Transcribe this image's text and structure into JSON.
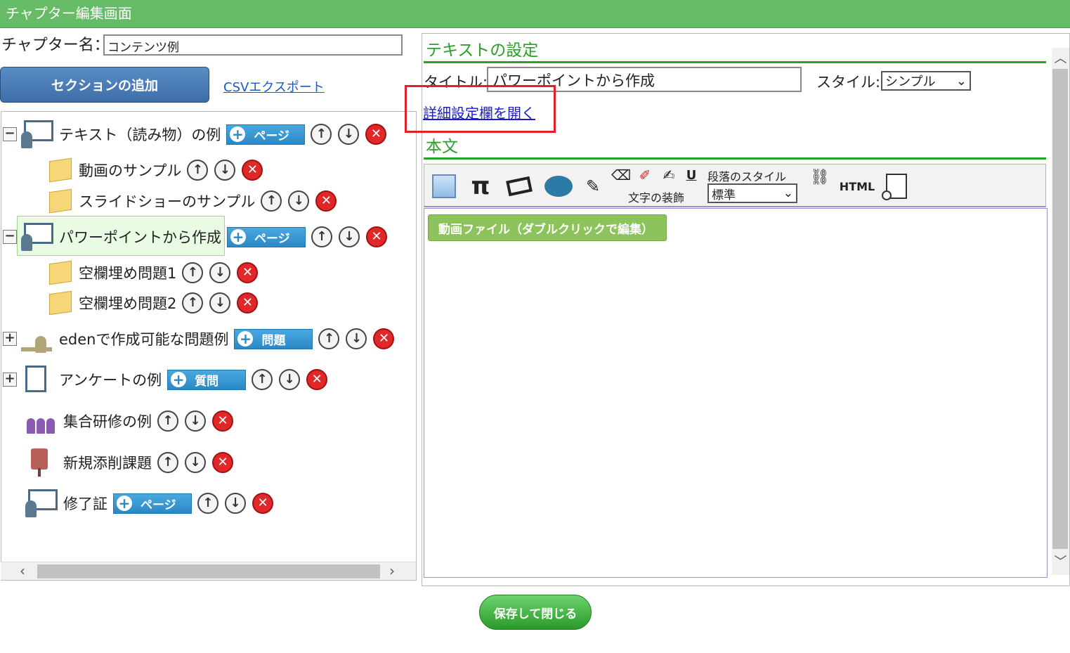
{
  "window": {
    "title": "チャプター編集画面"
  },
  "chapter": {
    "label": "チャプター名：",
    "value": "コンテンツ例"
  },
  "actions": {
    "add_section": "セクションの追加",
    "csv_export": "CSVエクスポート",
    "save_close": "保存して閉じる"
  },
  "tree": {
    "items": [
      {
        "label": "テキスト（読み物）の例",
        "toggle": "−",
        "add": "ページ"
      },
      {
        "label": "動画のサンプル"
      },
      {
        "label": "スライドショーのサンプル"
      },
      {
        "label": "パワーポイントから作成",
        "toggle": "−",
        "add": "ページ",
        "selected": true
      },
      {
        "label": "空欄埋め問題1"
      },
      {
        "label": "空欄埋め問題2"
      },
      {
        "label": "edenで作成可能な問題例",
        "toggle": "+",
        "add": "問題"
      },
      {
        "label": "アンケートの例",
        "toggle": "+",
        "add": "質問"
      },
      {
        "label": "集合研修の例"
      },
      {
        "label": "新規添削課題"
      },
      {
        "label": "修了証",
        "add": "ページ"
      }
    ],
    "up_glyph": "↑",
    "down_glyph": "↓",
    "delete_glyph": "✕"
  },
  "settings": {
    "section_title": "テキストの設定",
    "title_label": "タイトル:",
    "title_value": "パワーポイントから作成",
    "style_label": "スタイル:",
    "style_value": "シンプル",
    "detail_link": "詳細設定欄を開く",
    "body_title": "本文"
  },
  "toolbar": {
    "pi": "π",
    "text_deco_label": "文字の装飾",
    "underline": "U",
    "para_style_label": "段落のスタイル",
    "para_style_value": "標準",
    "html": "HTML"
  },
  "editor": {
    "video_block": "動画ファイル（ダブルクリックで編集）"
  },
  "colors": {
    "accent_green": "#66bb66",
    "link_blue": "#1a57c8",
    "highlight_red": "#e0202a"
  }
}
